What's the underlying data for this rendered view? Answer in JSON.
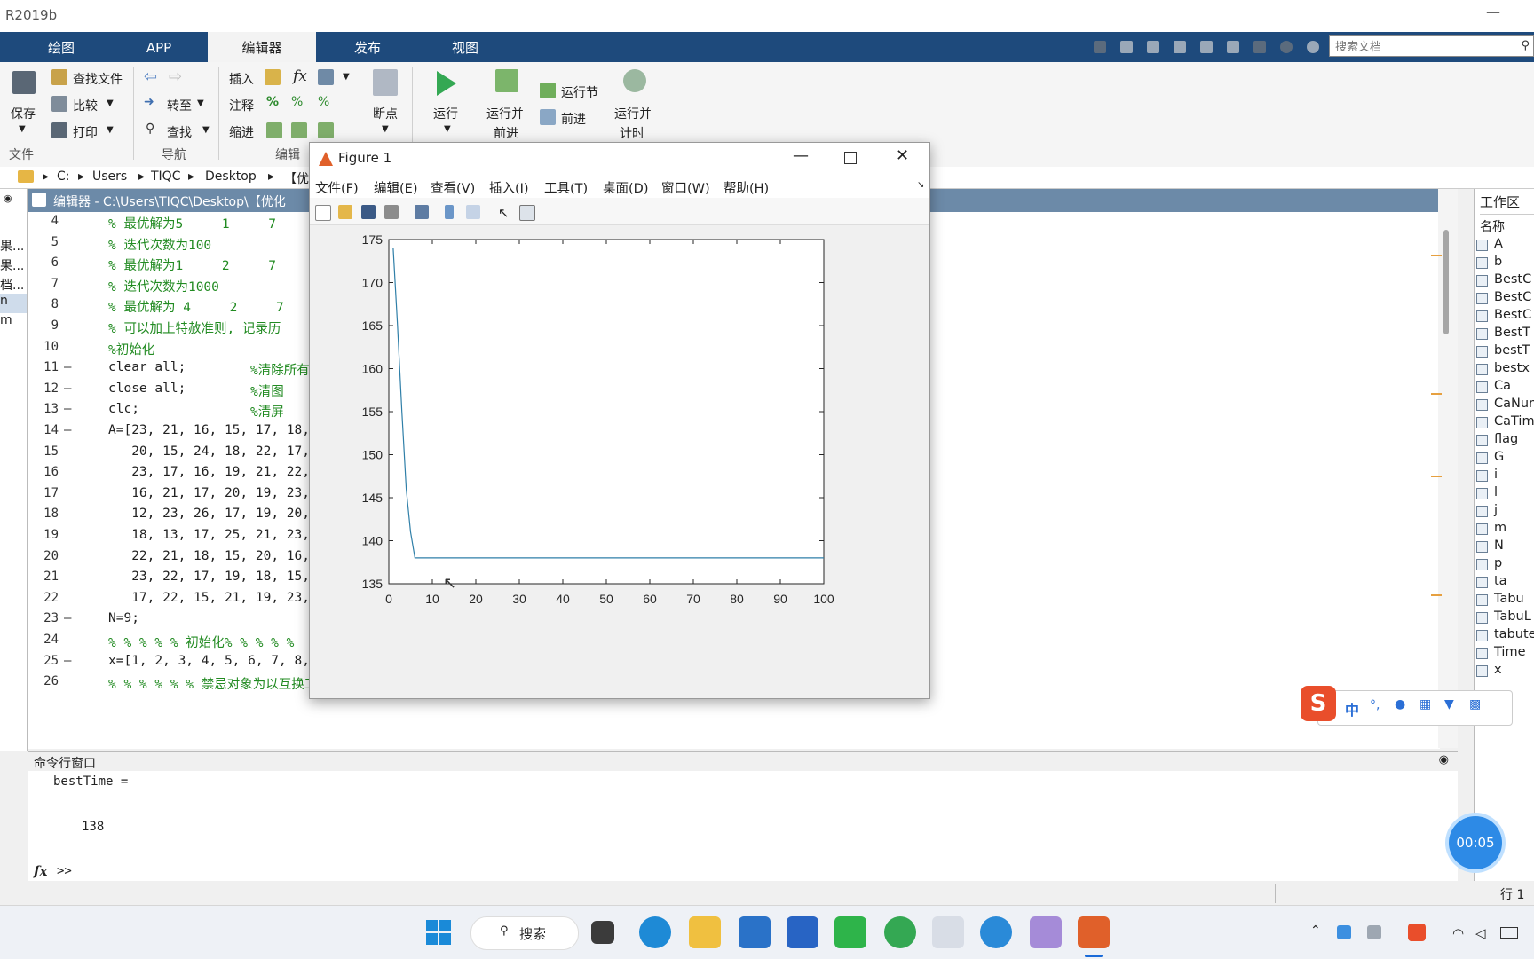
{
  "app": {
    "title": "R2019b",
    "minimize": "—"
  },
  "tabs": [
    "绘图",
    "APP",
    "编辑器",
    "发布",
    "视图"
  ],
  "search": {
    "placeholder": "搜索文档"
  },
  "ribbon": {
    "save": "保存",
    "find_files": "查找文件",
    "compare": "比较",
    "print": "打印",
    "goto": "转至",
    "find": "查找",
    "insert": "插入",
    "fx": "fx",
    "comment": "注释",
    "indent": "缩进",
    "breakpoints": "断点",
    "run": "运行",
    "run_advance": [
      "运行并",
      "前进"
    ],
    "run_section": "运行节",
    "advance": "前进",
    "run_time": [
      "运行并",
      "计时"
    ],
    "group_file": "文件",
    "group_nav": "导航",
    "group_edit": "编辑"
  },
  "address": [
    "C:",
    "Users",
    "TIQC",
    "Desktop",
    "【优"
  ],
  "left_files": [
    "果...",
    "果...",
    "档...",
    "n",
    "m"
  ],
  "editor": {
    "title": "编辑器 - C:\\Users\\TIQC\\Desktop\\【优化",
    "lines": [
      {
        "n": "4",
        "dash": "",
        "text": "% 最优解为5     1     7",
        "cls": "cm"
      },
      {
        "n": "5",
        "dash": "",
        "text": "% 迭代次数为100",
        "cls": "cm"
      },
      {
        "n": "6",
        "dash": "",
        "text": "% 最优解为1     2     7",
        "cls": "cm"
      },
      {
        "n": "7",
        "dash": "",
        "text": "% 迭代次数为1000",
        "cls": "cm"
      },
      {
        "n": "8",
        "dash": "",
        "text": "% 最优解为 4     2     7",
        "cls": "cm"
      },
      {
        "n": "9",
        "dash": "",
        "text": "% 可以加上特赦准则, 记录历",
        "cls": "cm"
      },
      {
        "n": "10",
        "dash": "",
        "text": "%初始化",
        "cls": "cm"
      },
      {
        "n": "11",
        "dash": "—",
        "text": "clear all;",
        "cls": "bl",
        "tail": "%清除所有"
      },
      {
        "n": "12",
        "dash": "—",
        "text": "close all;",
        "cls": "bl",
        "tail": "%清图"
      },
      {
        "n": "13",
        "dash": "—",
        "text": "clc;",
        "cls": "bl",
        "tail": "%清屏"
      },
      {
        "n": "14",
        "dash": "—",
        "text": "A=[23, 21, 16, 15, 17, 18, 20, 2",
        "cls": "bl"
      },
      {
        "n": "15",
        "dash": "",
        "text": "   20, 15, 24, 18, 22, 17, 21, 1",
        "cls": "bl"
      },
      {
        "n": "16",
        "dash": "",
        "text": "   23, 17, 16, 19, 21, 22, 13, 2",
        "cls": "bl"
      },
      {
        "n": "17",
        "dash": "",
        "text": "   16, 21, 17, 20, 19, 23, 16, 1",
        "cls": "bl"
      },
      {
        "n": "18",
        "dash": "",
        "text": "   12, 23, 26, 17, 19, 20, 13, 1",
        "cls": "bl"
      },
      {
        "n": "19",
        "dash": "",
        "text": "   18, 13, 17, 25, 21, 23, 16, 1",
        "cls": "bl"
      },
      {
        "n": "20",
        "dash": "",
        "text": "   22, 21, 18, 15, 20, 16, 19, 2",
        "cls": "bl"
      },
      {
        "n": "21",
        "dash": "",
        "text": "   23, 22, 17, 19, 18, 15, 20, 1",
        "cls": "bl"
      },
      {
        "n": "22",
        "dash": "",
        "text": "   17, 22, 15, 21, 19, 23, 18, 1",
        "cls": "bl"
      },
      {
        "n": "23",
        "dash": "—",
        "text": "N=9;",
        "cls": "bl"
      },
      {
        "n": "24",
        "dash": "",
        "text": "% % % % % 初始化% % % % %",
        "cls": "cm"
      },
      {
        "n": "25",
        "dash": "—",
        "text": "x=[1, 2, 3, 4, 5, 6, 7, 8, 9];",
        "cls": "bl",
        "tail": "%给定初始解"
      },
      {
        "n": "26",
        "dash": "",
        "text": "% % % % % % 禁忌对象为以互换工作的两人构成的数对% % % % % % % % % % %",
        "cls": "cm"
      }
    ]
  },
  "command": {
    "header": "命令行窗口",
    "output_name": "bestTime =",
    "output_value": "138",
    "prompt": ">>",
    "fx": "fx"
  },
  "workspace": {
    "header": "工作区",
    "col": "名称",
    "vars": [
      "A",
      "b",
      "BestC",
      "BestC",
      "BestC",
      "BestT",
      "bestT",
      "bestx",
      "Ca",
      "CaNur",
      "CaTim",
      "flag",
      "G",
      "i",
      "l",
      "j",
      "m",
      "N",
      "p",
      "ta",
      "Tabu",
      "TabuL",
      "tabute",
      "Time",
      "x"
    ]
  },
  "status": {
    "line_label": "行 1"
  },
  "taskbar": {
    "search": "搜索"
  },
  "timer": "00:05",
  "ime": {
    "label": "中"
  },
  "figure": {
    "title": "Figure 1",
    "menu": [
      "文件(F)",
      "编辑(E)",
      "查看(V)",
      "插入(I)",
      "工具(T)",
      "桌面(D)",
      "窗口(W)",
      "帮助(H)"
    ]
  },
  "colors": {
    "ribbon_tab_bg": "#1e4a7c",
    "plot_line": "#2f7fa8",
    "comment": "#228b22",
    "keyword": "#a020f0"
  },
  "chart_data": {
    "type": "line",
    "title": "",
    "xlabel": "",
    "ylabel": "",
    "xlim": [
      0,
      100
    ],
    "ylim": [
      135,
      175
    ],
    "xticks": [
      0,
      10,
      20,
      30,
      40,
      50,
      60,
      70,
      80,
      90,
      100
    ],
    "yticks": [
      135,
      140,
      145,
      150,
      155,
      160,
      165,
      170,
      175
    ],
    "series": [
      {
        "x": [
          1,
          2,
          3,
          4,
          5,
          6,
          10,
          20,
          40,
          60,
          80,
          100
        ],
        "y": [
          174,
          165,
          155,
          146,
          141,
          138,
          138,
          138,
          138,
          138,
          138,
          138
        ]
      }
    ]
  }
}
